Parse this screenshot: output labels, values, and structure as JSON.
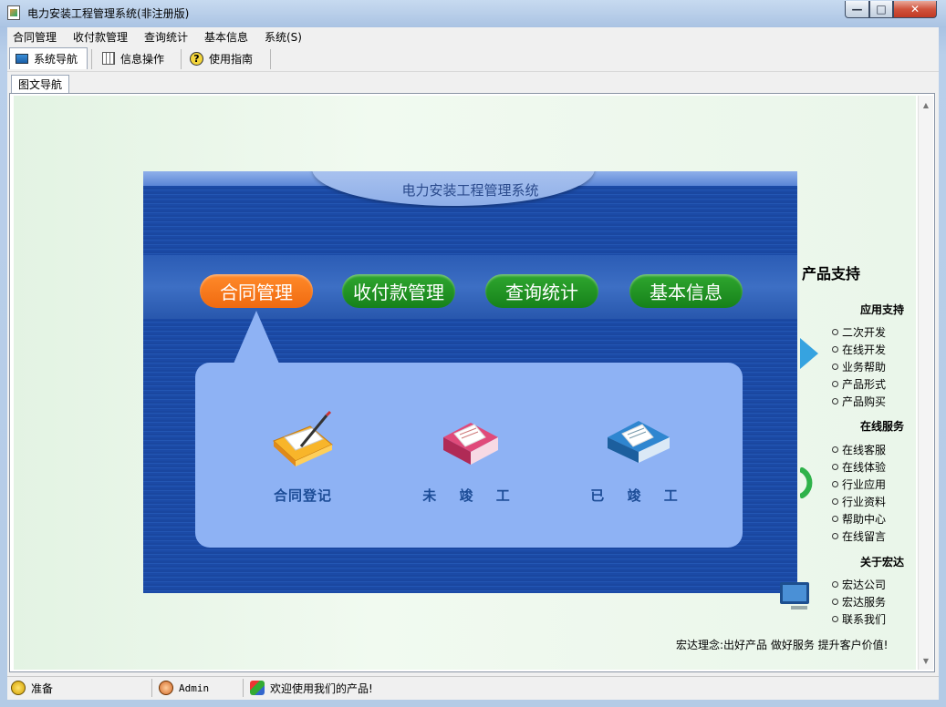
{
  "window": {
    "title": "电力安装工程管理系统(非注册版)",
    "min_glyph": "—",
    "max_glyph": "□",
    "close_glyph": "✕"
  },
  "menu": [
    "合同管理",
    "收付款管理",
    "查询统计",
    "基本信息",
    "系统(S)"
  ],
  "toolbar": [
    {
      "label": "系统导航",
      "icon": "monitor-icon"
    },
    {
      "label": "信息操作",
      "icon": "grid-icon"
    },
    {
      "label": "使用指南",
      "icon": "help-icon",
      "glyph": "?"
    }
  ],
  "doc_tab": {
    "label": "图文导航"
  },
  "banner": {
    "title": "电力安装工程管理系统",
    "nav": [
      {
        "label": "合同管理",
        "color": "#f26d13",
        "active": true
      },
      {
        "label": "收付款管理",
        "color": "#1a8a1e"
      },
      {
        "label": "查询统计",
        "color": "#1a8a1e"
      },
      {
        "label": "基本信息",
        "color": "#1a8a1e"
      }
    ],
    "features": [
      {
        "label": "合同登记",
        "icon": "contract-register-icon"
      },
      {
        "label": "未 竣 工",
        "icon": "unfinished-book-icon"
      },
      {
        "label": "已 竣 工",
        "icon": "finished-book-icon"
      }
    ]
  },
  "side": {
    "title": "产品支持",
    "sections": [
      {
        "heading": "应用支持",
        "items": [
          "二次开发",
          "在线开发",
          "业务帮助",
          "产品形式",
          "产品购买"
        ]
      },
      {
        "heading": "在线服务",
        "items": [
          "在线客服",
          "在线体验",
          "行业应用",
          "行业资料",
          "帮助中心",
          "在线留言"
        ]
      },
      {
        "heading": "关于宏达",
        "items": [
          "宏达公司",
          "宏达服务",
          "联系我们"
        ]
      }
    ],
    "motto": "宏达理念:出好产品 做好服务 提升客户价值!"
  },
  "status": {
    "state": "准备",
    "user": "Admin",
    "welcome": "欢迎使用我们的产品!"
  },
  "colors": {
    "accent_orange": "#f26d13",
    "accent_green": "#1a8a1e",
    "banner_blue": "#1f50aa",
    "callout_blue": "#8eb2f4"
  }
}
